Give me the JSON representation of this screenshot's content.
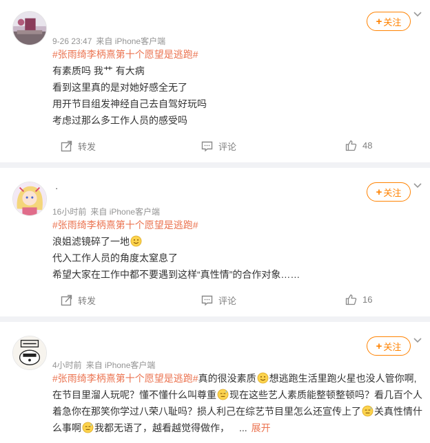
{
  "colors": {
    "accent": "#ff8200",
    "topic": "#eb7350",
    "meta": "#939393",
    "background": "#f1f2f5"
  },
  "icons": {
    "follow": "plus-icon",
    "more": "chevron-down-icon",
    "repost": "repost-icon",
    "comment": "comment-icon",
    "like": "thumbs-up-icon",
    "emoji_smile": "smile-emoji",
    "emoji_sweat": "sweat-emoji"
  },
  "posts": [
    {
      "username": "",
      "follow_label": "关注",
      "time": "9-26 23:47",
      "source": "来自 iPhone客户端",
      "lines": [
        {
          "topic": "#张雨绮李柄熹第十个愿望是逃跑#",
          "text": ""
        },
        {
          "text": "有素质吗 我艹 有大病"
        },
        {
          "text": "看到这里真的是对她好感全无了"
        },
        {
          "text": "用开节目组发神经自己去自驾好玩吗"
        },
        {
          "text": "考虑过那么多工作人员的感受吗"
        }
      ],
      "actions": {
        "repost": "转发",
        "comment": "评论",
        "likes": "48"
      }
    },
    {
      "username": "·",
      "follow_label": "关注",
      "time": "16小时前",
      "source": "来自 iPhone客户端",
      "lines": [
        {
          "topic": "#张雨绮李柄熹第十个愿望是逃跑#",
          "text": ""
        },
        {
          "text": "浪姐滤镜碎了一地"
        },
        {
          "text": "代入工作人员的角度太窒息了"
        },
        {
          "text": "希望大家在工作中都不要遇到这样“真性情”的合作对象……"
        }
      ],
      "actions": {
        "repost": "转发",
        "comment": "评论",
        "likes": "16"
      }
    },
    {
      "username": "",
      "follow_label": "关注",
      "time": "4小时前",
      "source": "来自 iPhone客户端",
      "lines": [
        {
          "topic": "#张雨绮李柄熹第十个愿望是逃跑#",
          "seg1": "真的很没素质",
          "seg2": "想逃跑生活里跑火星也没人管你啊,"
        },
        {
          "seg1": "在节目里溜人玩呢？懂不懂什么叫尊重",
          "seg2": "现在这些艺人素质能整顿整顿吗？看几百个人"
        },
        {
          "seg1": "着急你在那笑你学过八荣八耻吗？损人利己在综艺节目里怎么还宣传上了",
          "seg2": "关真性情什"
        },
        {
          "seg1": "么事啊",
          "seg2": "我都无语了，越看越觉得做作，",
          "ellipsis": "...",
          "expand": "展开"
        }
      ]
    }
  ]
}
